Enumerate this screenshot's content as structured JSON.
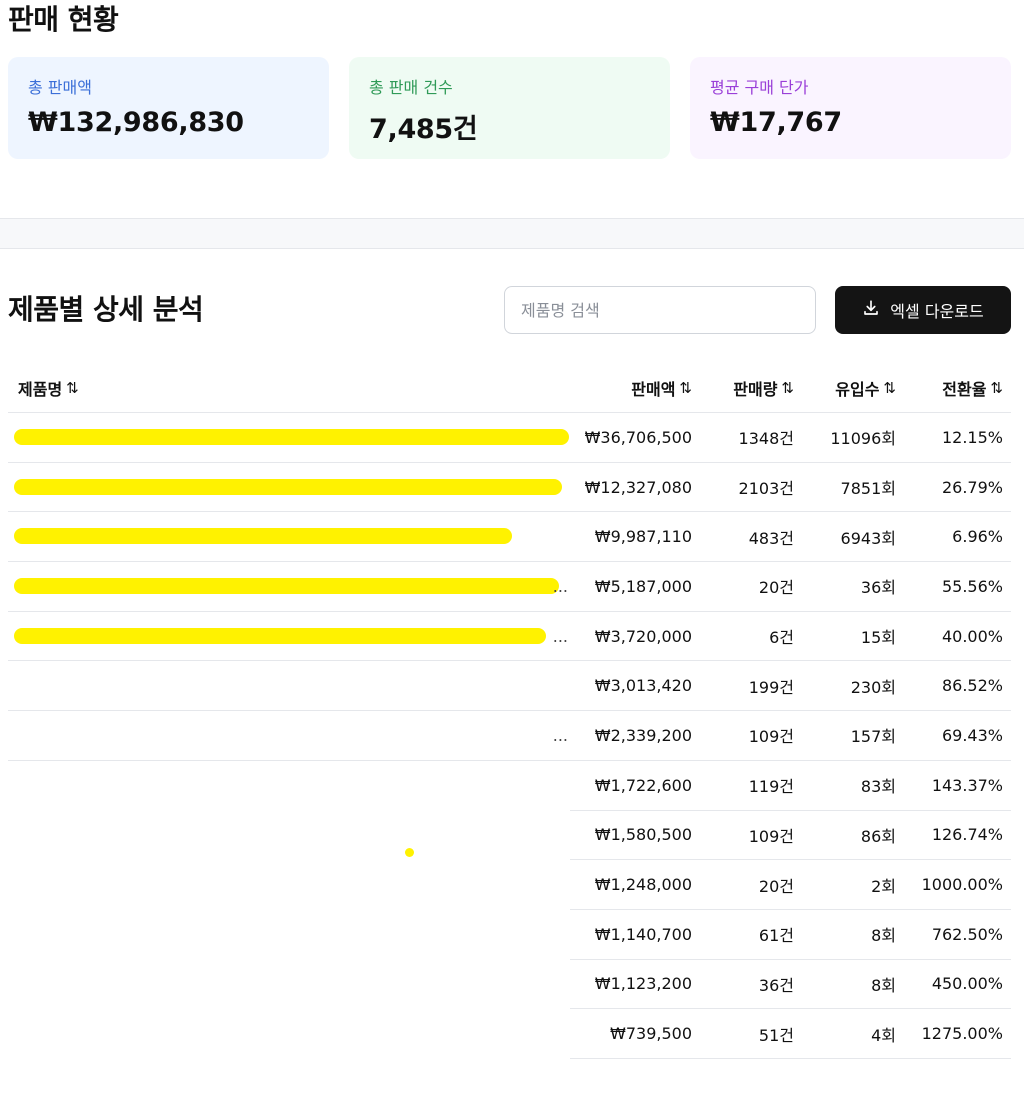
{
  "page_title": "판매 현황",
  "stats": [
    {
      "label": "총 판매액",
      "value": "₩132,986,830",
      "bg": "#eef5ff",
      "label_color": "#3b6fd8"
    },
    {
      "label": "총 판매 건수",
      "value": "7,485건",
      "bg": "#effbf3",
      "label_color": "#2f9a57"
    },
    {
      "label": "평균 구매 단가",
      "value": "₩17,767",
      "bg": "#faf4ff",
      "label_color": "#9a3fd8"
    }
  ],
  "section_title": "제품별 상세 분석",
  "search": {
    "placeholder": "제품명 검색"
  },
  "download": {
    "label": "엑셀 다운로드",
    "icon": "download-icon"
  },
  "table": {
    "headers": {
      "name": "제품명",
      "amount": "판매액",
      "qty": "판매량",
      "visits": "유입수",
      "rate": "전환율"
    },
    "sort_icon": "⇅",
    "rows": [
      {
        "name": "",
        "amount": "₩36,706,500",
        "qty": "1348건",
        "visits": "11096회",
        "rate": "12.15%",
        "redacted": true,
        "ellipsis": ""
      },
      {
        "name": "",
        "amount": "₩12,327,080",
        "qty": "2103건",
        "visits": "7851회",
        "rate": "26.79%",
        "redacted": true,
        "ellipsis": ""
      },
      {
        "name": "",
        "amount": "₩9,987,110",
        "qty": "483건",
        "visits": "6943회",
        "rate": "6.96%",
        "redacted": true,
        "ellipsis": ""
      },
      {
        "name": "",
        "amount": "₩5,187,000",
        "qty": "20건",
        "visits": "36회",
        "rate": "55.56%",
        "redacted": true,
        "ellipsis": "..."
      },
      {
        "name": "",
        "amount": "₩3,720,000",
        "qty": "6건",
        "visits": "15회",
        "rate": "40.00%",
        "redacted": true,
        "ellipsis": "..."
      },
      {
        "name": "",
        "amount": "₩3,013,420",
        "qty": "199건",
        "visits": "230회",
        "rate": "86.52%",
        "redacted": false,
        "ellipsis": ""
      },
      {
        "name": "",
        "amount": "₩2,339,200",
        "qty": "109건",
        "visits": "157회",
        "rate": "69.43%",
        "redacted": false,
        "ellipsis": "..."
      },
      {
        "name": "",
        "amount": "₩1,722,600",
        "qty": "119건",
        "visits": "83회",
        "rate": "143.37%",
        "redacted": false,
        "ellipsis": ""
      },
      {
        "name": "",
        "amount": "₩1,580,500",
        "qty": "109건",
        "visits": "86회",
        "rate": "126.74%",
        "redacted": false,
        "ellipsis": ""
      },
      {
        "name": "",
        "amount": "₩1,248,000",
        "qty": "20건",
        "visits": "2회",
        "rate": "1000.00%",
        "redacted": false,
        "ellipsis": ""
      },
      {
        "name": "",
        "amount": "₩1,140,700",
        "qty": "61건",
        "visits": "8회",
        "rate": "762.50%",
        "redacted": false,
        "ellipsis": ""
      },
      {
        "name": "",
        "amount": "₩1,123,200",
        "qty": "36건",
        "visits": "8회",
        "rate": "450.00%",
        "redacted": false,
        "ellipsis": ""
      },
      {
        "name": "",
        "amount": "₩739,500",
        "qty": "51건",
        "visits": "4회",
        "rate": "1275.00%",
        "redacted": false,
        "ellipsis": ""
      }
    ]
  }
}
